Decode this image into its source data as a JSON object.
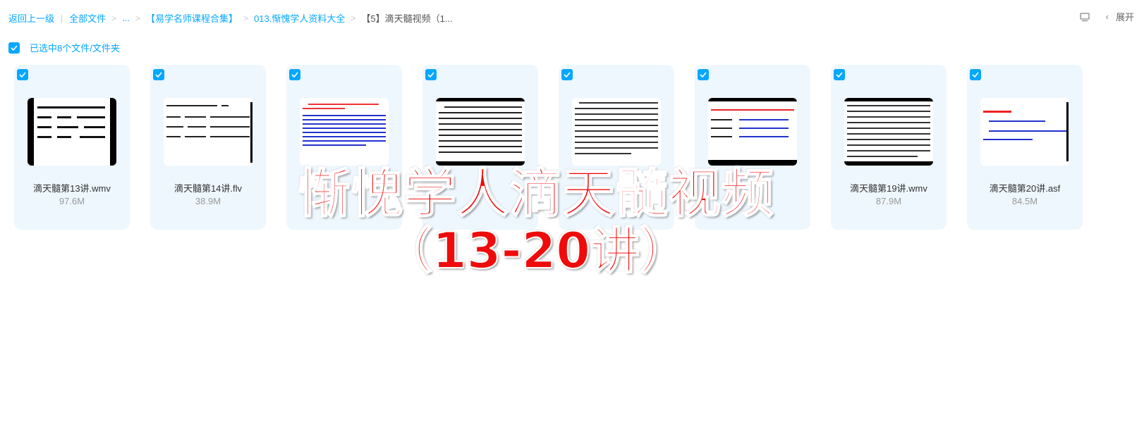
{
  "breadcrumb": {
    "back": "返回上一级",
    "all_files": "全部文件",
    "ellipsis": "...",
    "folder1": "【易学名师课程合集】",
    "folder2": "013.惭愧学人资料大全",
    "current": "【5】滴天髓视频（1..."
  },
  "toolbar": {
    "expand_label": "展开"
  },
  "selection": {
    "label": "已选中8个文件/文件夹"
  },
  "colors": {
    "accent": "#06a7ff",
    "card_bg": "#eef7fe",
    "overlay_red": "#ef0b0b"
  },
  "files": [
    {
      "name": "滴天髓第13讲.wmv",
      "size": "97.6M"
    },
    {
      "name": "滴天髓第14讲.flv",
      "size": "38.9M"
    },
    {
      "name": "",
      "size": ""
    },
    {
      "name": "",
      "size": ""
    },
    {
      "name": "",
      "size": ""
    },
    {
      "name": "",
      "size": ""
    },
    {
      "name": "滴天髓第19讲.wmv",
      "size": "87.9M"
    },
    {
      "name": "滴天髓第20讲.asf",
      "size": "84.5M"
    }
  ],
  "overlay": {
    "line1": "惭愧学人滴天髓视频",
    "line2": "（13-20讲）"
  }
}
